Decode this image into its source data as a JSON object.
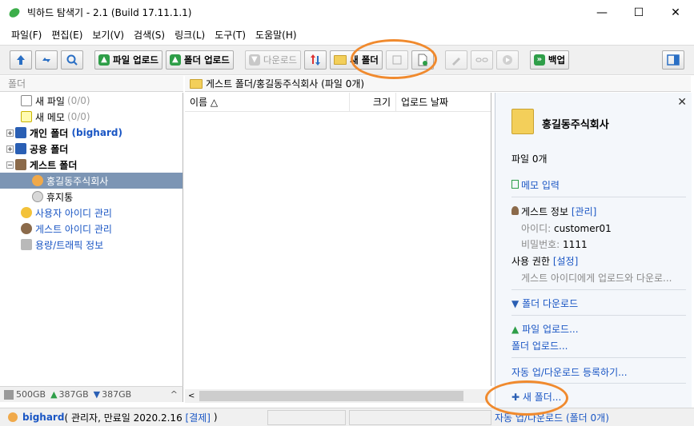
{
  "window": {
    "title": "빅하드 탐색기 - 2.1 (Build 17.11.1.1)",
    "minimize": "—",
    "maximize": "☐",
    "close": "✕"
  },
  "menu": [
    "파일(F)",
    "편집(E)",
    "보기(V)",
    "검색(S)",
    "링크(L)",
    "도구(T)",
    "도움말(H)"
  ],
  "toolbar": {
    "upload_file": "파일 업로드",
    "upload_folder": "폴더 업로드",
    "download": "다운로드",
    "new_folder": "새 폴더",
    "backup": "백업"
  },
  "left": {
    "header": "폴더",
    "items": [
      {
        "label": "새 파일",
        "count": "(0/0)"
      },
      {
        "label": "새 메모",
        "count": "(0/0)"
      },
      {
        "label": "개인 폴더",
        "sub": "(bighard)"
      },
      {
        "label": "공용 폴더"
      },
      {
        "label": "게스트 폴더"
      },
      {
        "label": "홍길동주식회사"
      },
      {
        "label": "휴지통"
      },
      {
        "label": "사용자 아이디 관리"
      },
      {
        "label": "게스트 아이디 관리"
      },
      {
        "label": "용량/트래픽 정보"
      }
    ],
    "storage": {
      "total": "500GB",
      "up": "387GB",
      "down": "387GB"
    }
  },
  "path": "게스트 폴더/홍길동주식회사 (파일 0개)",
  "file_list": {
    "columns": [
      "이름 △",
      "크기",
      "업로드 날짜"
    ]
  },
  "details": {
    "folder_name": "홍길동주식회사",
    "file_count": "파일 0개",
    "memo": "메모 입력",
    "guest_info": "게스트 정보",
    "manage": "[관리]",
    "id_label": "아이디:",
    "id_value": "customer01",
    "pw_label": "비밀번호:",
    "pw_value": "1111",
    "permission": "사용 권한",
    "setting": "[설정]",
    "permission_desc": "게스트 아이디에게 업로드와 다운로...",
    "folder_download": "폴더 다운로드",
    "file_upload": "파일 업로드...",
    "folder_upload": "폴더 업로드...",
    "auto_sync": "자동 업/다운로드 등록하기...",
    "new_folder": "새 폴더..."
  },
  "status": {
    "user": "bighard",
    "info": "( 관리자, 만료일 2020.2.16",
    "pay": "[결제]",
    "close_paren": ")",
    "auto": "자동 업/다운로드 (폴더 0개)"
  },
  "colors": {
    "accent": "#1a56c4",
    "selection": "#7c95b4",
    "highlight": "#f08a2e",
    "green": "#2e9e48"
  }
}
